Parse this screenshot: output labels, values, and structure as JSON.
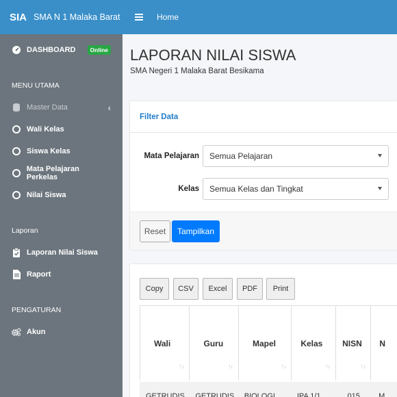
{
  "brand": {
    "logo": "SIA",
    "name": "SMA N 1 Malaka Barat"
  },
  "topbar": {
    "home_label": "Home"
  },
  "sidebar": {
    "dashboard": {
      "label": "DASHBOARD",
      "badge": "Online"
    },
    "menu_header": "MENU UTAMA",
    "master_data": "Master Data",
    "items": [
      {
        "label": "Wali Kelas"
      },
      {
        "label": "Siswa Kelas"
      },
      {
        "label": "Mata Pelajaran Perkelas"
      },
      {
        "label": "Nilai Siswa"
      }
    ],
    "laporan_header": "Laporan",
    "laporan_items": [
      {
        "label": "Laporan Nilai Siswa"
      },
      {
        "label": "Raport"
      }
    ],
    "pengaturan_header": "PENGATURAN",
    "akun": "Akun"
  },
  "page": {
    "title": "LAPORAN NILAI SISWA",
    "subtitle": "SMA Negeri 1 Malaka Barat Besikama"
  },
  "filter": {
    "header": "Filter Data",
    "mapel_label": "Mata Pelajaran",
    "mapel_value": "Semua Pelajaran",
    "kelas_label": "Kelas",
    "kelas_value": "Semua Kelas dan Tingkat",
    "reset_label": "Reset",
    "show_label": "Tampilkan"
  },
  "export_buttons": [
    "Copy",
    "CSV",
    "Excel",
    "PDF",
    "Print"
  ],
  "table": {
    "headers": [
      "Wali",
      "Guru",
      "Mapel",
      "Kelas",
      "NISN",
      "N"
    ],
    "first_row": [
      "GETRUDIS",
      "GETRUDIS",
      "BIOLOGI",
      "IPA 1/1",
      "015",
      "M"
    ]
  }
}
